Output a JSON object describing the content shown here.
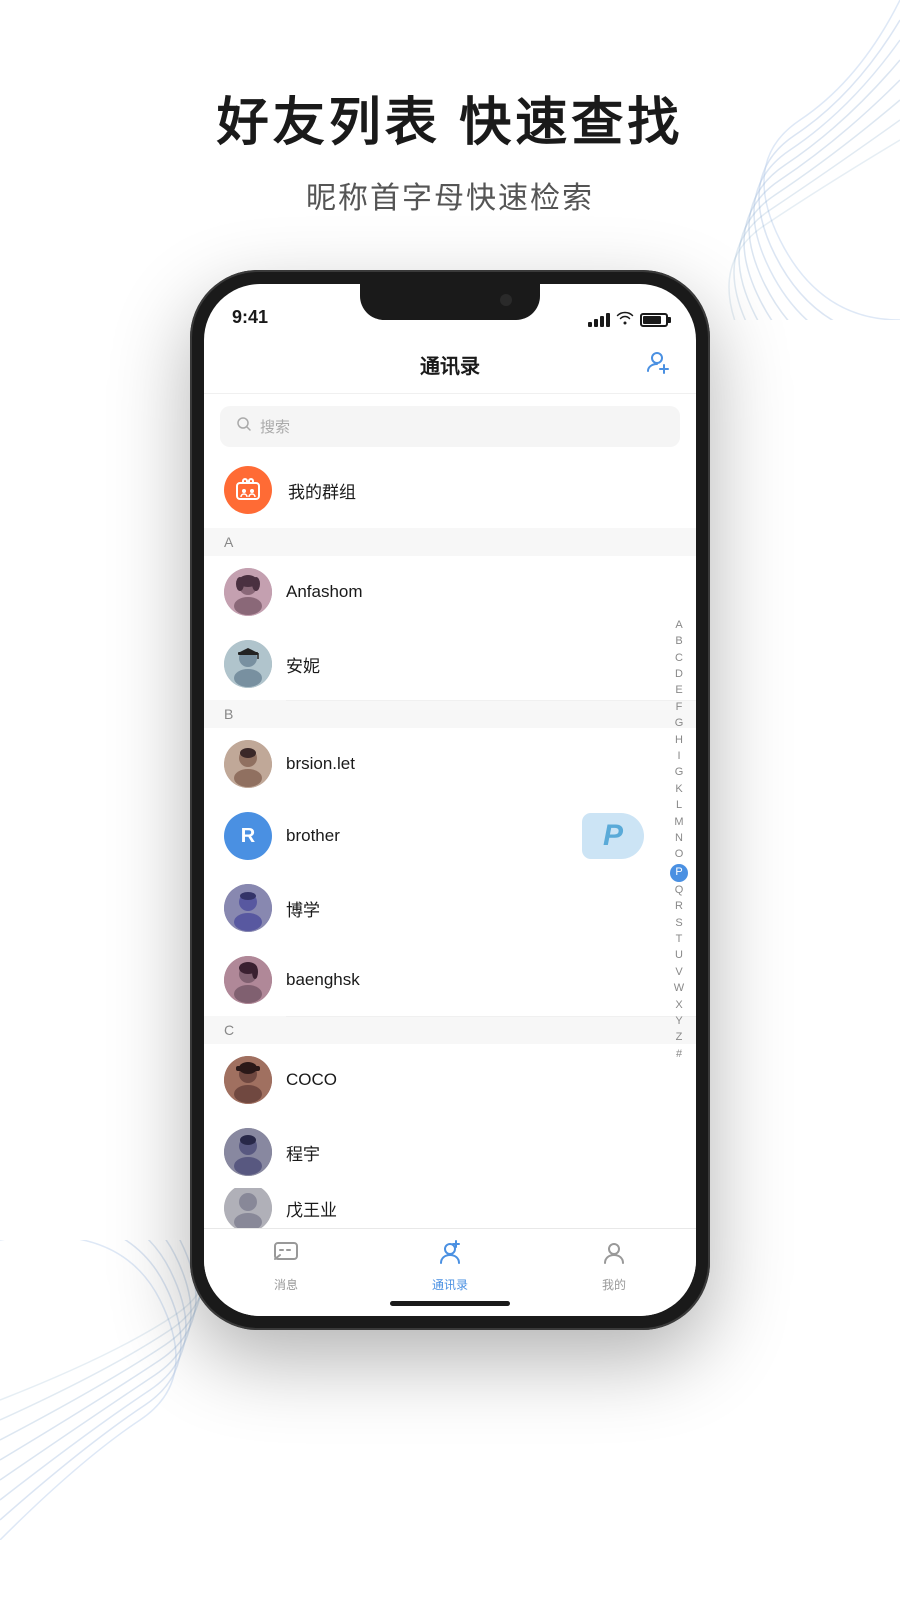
{
  "page": {
    "title": "好友列表 快速查找",
    "subtitle": "昵称首字母快速检索"
  },
  "phone": {
    "status_time": "9:41"
  },
  "app": {
    "nav_title": "通讯录",
    "search_placeholder": "搜索",
    "my_groups": "我的群组",
    "add_button_label": "添加"
  },
  "sections": [
    {
      "letter": "A",
      "contacts": [
        {
          "id": "anfashom",
          "name": "Anfashom",
          "avatar_type": "photo"
        },
        {
          "id": "anni",
          "name": "安妮",
          "avatar_type": "photo"
        }
      ]
    },
    {
      "letter": "B",
      "contacts": [
        {
          "id": "brsion",
          "name": "brsion.let",
          "avatar_type": "photo"
        },
        {
          "id": "brother",
          "name": "brother",
          "avatar_letter": "R",
          "avatar_type": "letter",
          "badge": "P"
        },
        {
          "id": "boxue",
          "name": "博学",
          "avatar_type": "photo"
        },
        {
          "id": "baenghsk",
          "name": "baenghsk",
          "avatar_type": "photo"
        }
      ]
    },
    {
      "letter": "C",
      "contacts": [
        {
          "id": "coco",
          "name": "COCO",
          "avatar_type": "photo"
        },
        {
          "id": "chengyu",
          "name": "程宇",
          "avatar_type": "photo"
        },
        {
          "id": "partial",
          "name": "戊王业",
          "avatar_type": "photo",
          "partial": true
        }
      ]
    }
  ],
  "alpha_index": [
    "A",
    "B",
    "C",
    "D",
    "E",
    "F",
    "G",
    "H",
    "I",
    "G",
    "K",
    "L",
    "M",
    "N",
    "O",
    "P",
    "Q",
    "R",
    "S",
    "T",
    "U",
    "V",
    "W",
    "X",
    "Y",
    "Z",
    "#"
  ],
  "alpha_active": "P",
  "tabs": [
    {
      "id": "messages",
      "label": "消息",
      "icon": "chat",
      "active": false
    },
    {
      "id": "contacts",
      "label": "通讯录",
      "icon": "contacts",
      "active": true
    },
    {
      "id": "mine",
      "label": "我的",
      "icon": "person",
      "active": false
    }
  ]
}
